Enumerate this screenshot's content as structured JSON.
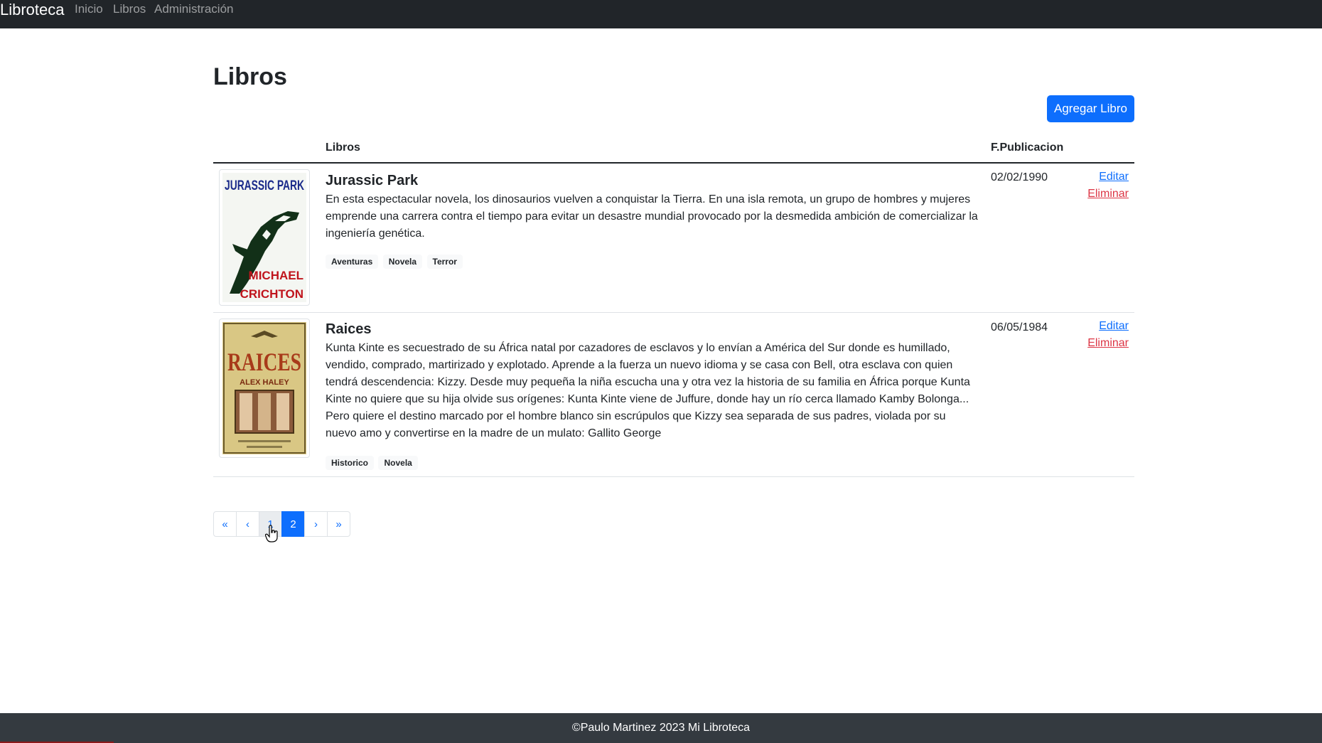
{
  "nav": {
    "brand": "Libroteca",
    "links": [
      "Inicio",
      "Libros",
      "Administración"
    ]
  },
  "page": {
    "title": "Libros",
    "add_button": "Agregar Libro"
  },
  "table": {
    "headers": {
      "books": "Libros",
      "date": "F.Publicacion"
    },
    "rows": [
      {
        "title": "Jurassic Park",
        "description": "En esta espectacular novela, los dinosaurios vuelven a conquistar la Tierra. En una isla remota, un grupo de hombres y mujeres emprende una carrera contra el tiempo para evitar un desastre mundial provocado por la desmedida ambición de comercializar la ingeniería genética.",
        "tags": [
          "Aventuras",
          "Novela",
          "Terror"
        ],
        "date": "02/02/1990",
        "edit": "Editar",
        "delete": "Eliminar",
        "cover_title": "JURASSIC PARK",
        "cover_author_1": "MICHAEL",
        "cover_author_2": "CRICHTON"
      },
      {
        "title": "Raices",
        "description": "Kunta Kinte es secuestrado de su África natal por cazadores de esclavos y lo envían a América del Sur donde es humillado, vendido, comprado, martirizado y explotado. Aprende a la fuerza un nuevo idioma y se casa con Bell, otra esclava con quien tendrá descendencia: Kizzy. Desde muy pequeña la niña escucha una y otra vez la historia de su familia en África porque Kunta Kinte no quiere que su hija olvide sus orígenes: Kunta Kinte viene de Juffure, donde hay un río cerca llamado Kamby Bolonga... Pero quiere el destino marcado por el hombre blanco sin escrúpulos que Kizzy sea separada de sus padres, violada por su nuevo amo y convertirse en la madre de un mulato: Gallito George",
        "tags": [
          "Historico",
          "Novela"
        ],
        "date": "06/05/1984",
        "edit": "Editar",
        "delete": "Eliminar",
        "cover_title": "RAICES",
        "cover_author": "ALEX HALEY"
      }
    ]
  },
  "pagination": {
    "first": "«",
    "prev": "‹",
    "pages": [
      "1",
      "2"
    ],
    "active_page": "2",
    "next": "›",
    "last": "»"
  },
  "footer": {
    "text": "©Paulo Martinez 2023 Mi Libroteca"
  },
  "colors": {
    "primary": "#0d6efd",
    "danger": "#dc3545",
    "navbar": "#212529",
    "footer": "#343a40"
  }
}
